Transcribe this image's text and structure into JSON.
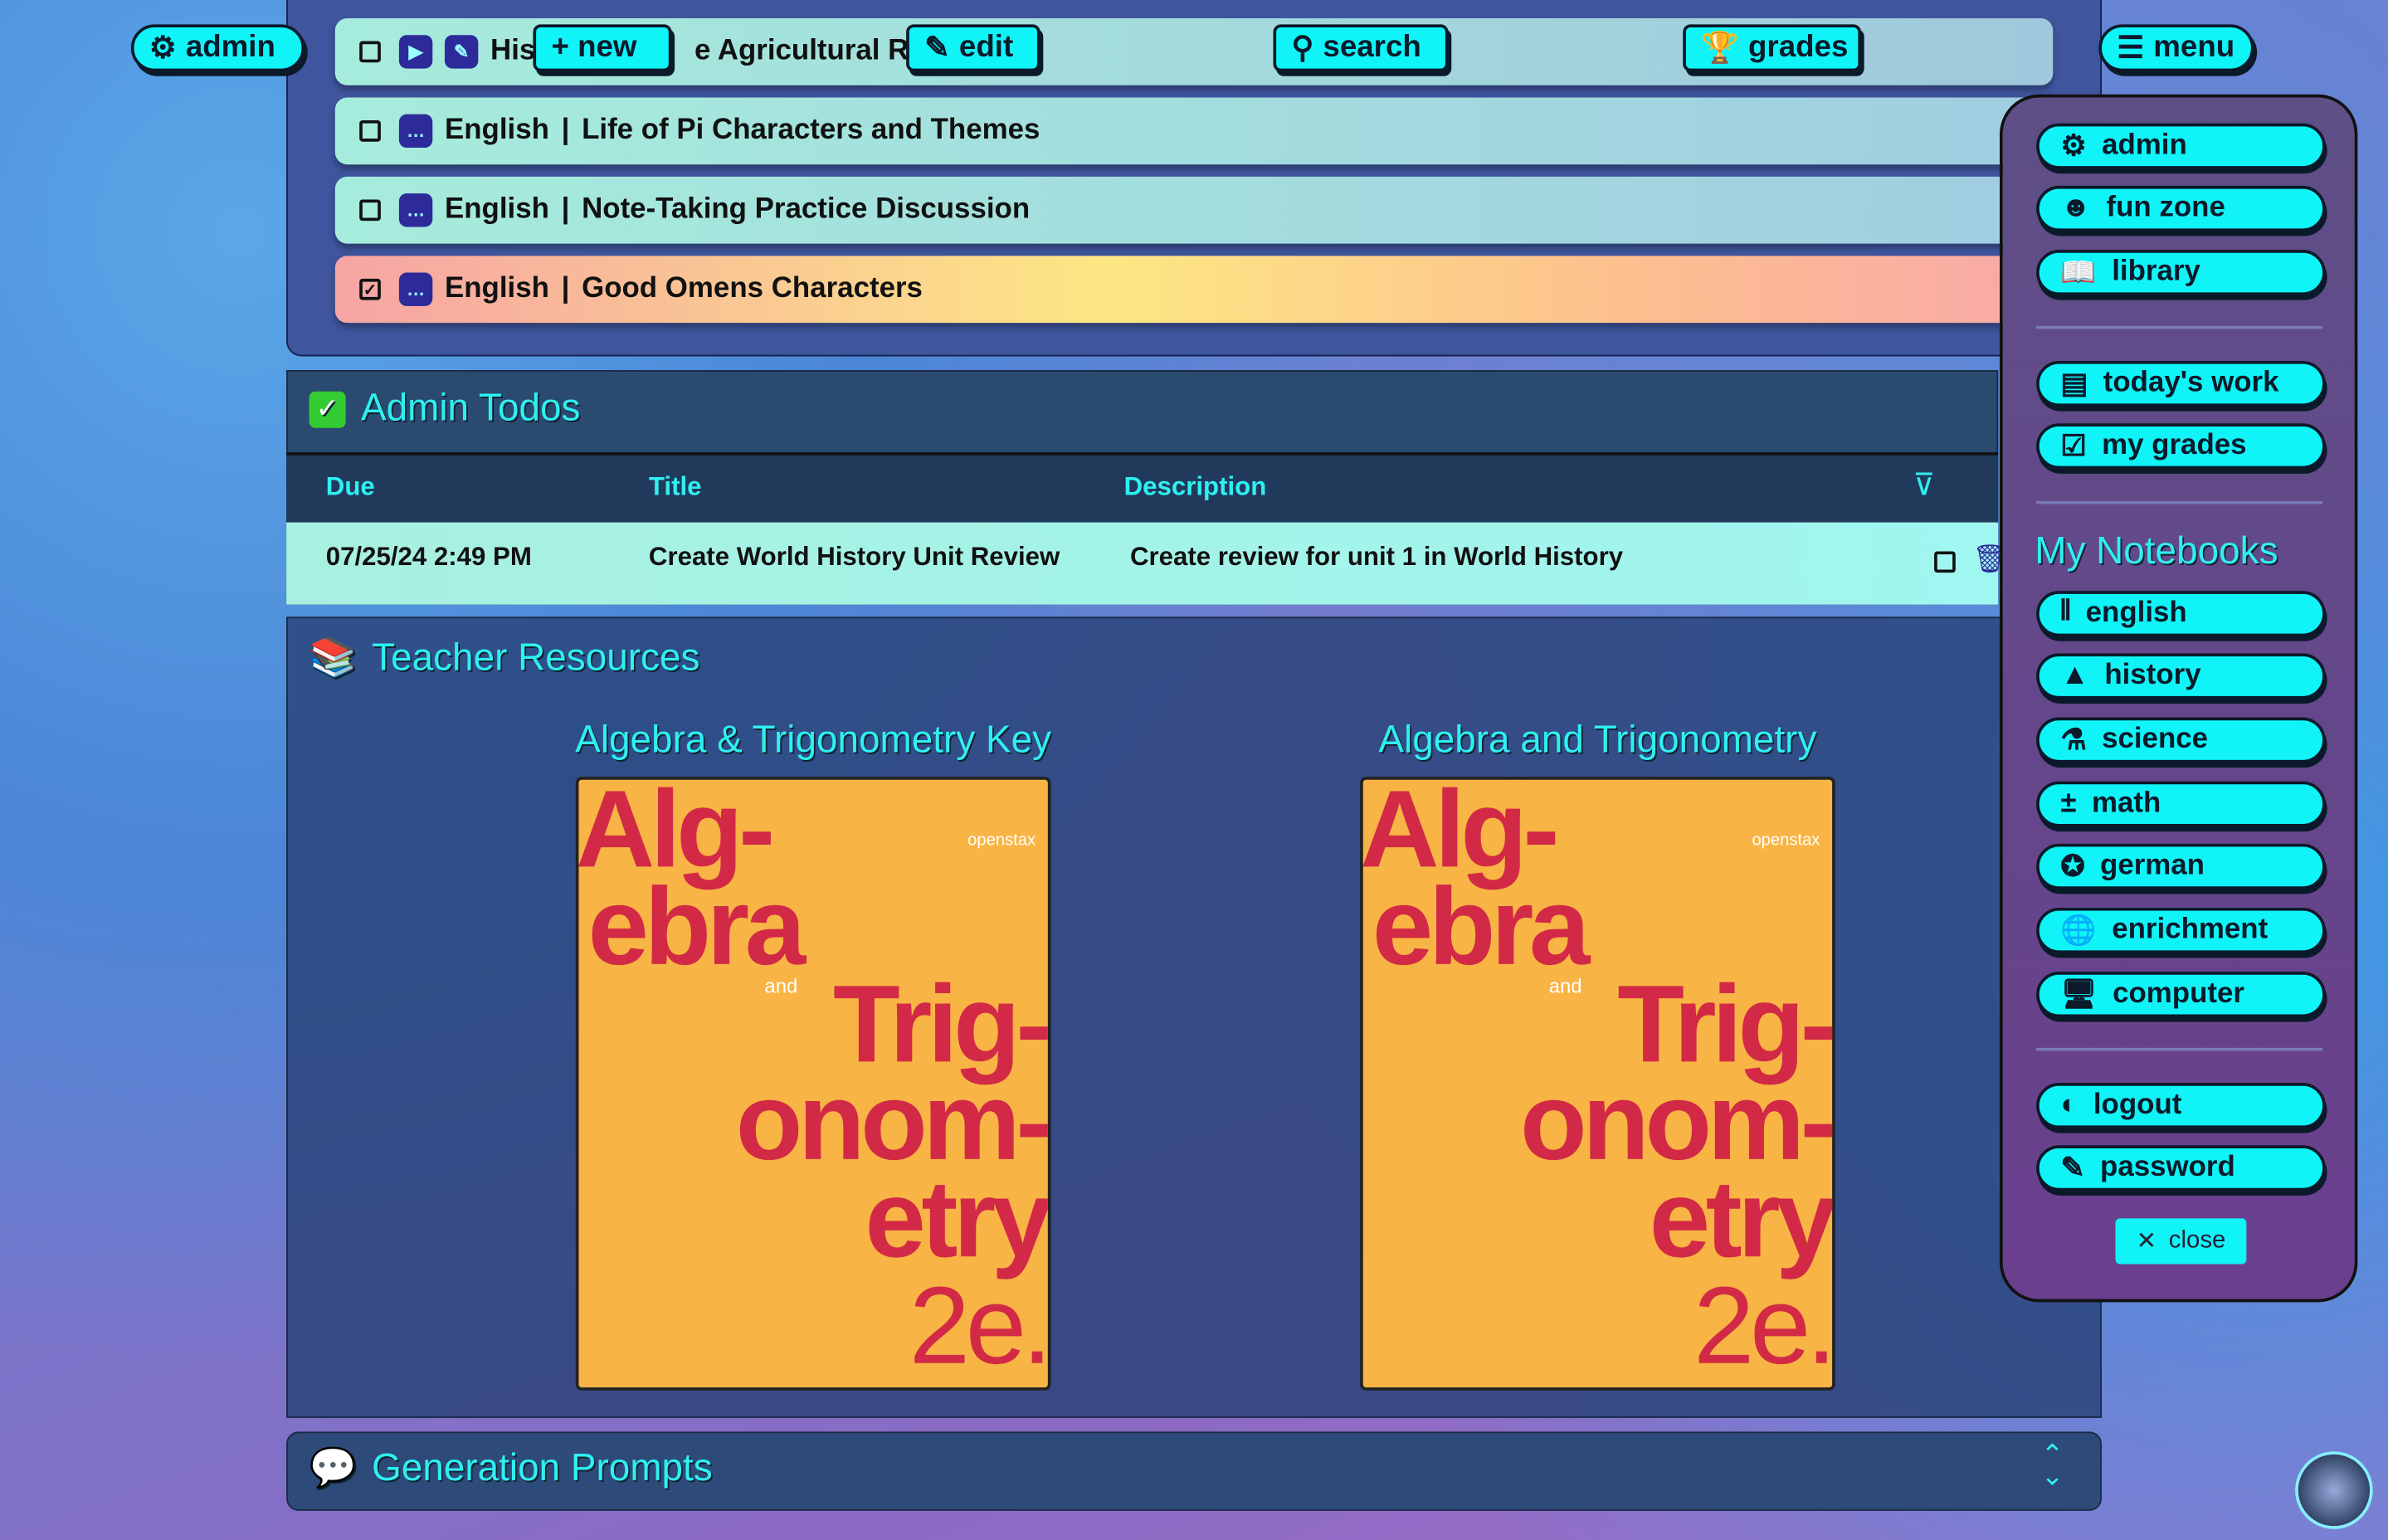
{
  "top_buttons": {
    "admin": "admin",
    "new": "+ new",
    "edit": "edit",
    "search": "search",
    "grades": "grades",
    "menu": "menu"
  },
  "assignments": [
    {
      "visible_parts": [
        "His",
        "e Agricultural Re"
      ],
      "icons": [
        "video-icon",
        "pencil-icon"
      ],
      "checked": false
    },
    {
      "subject": "English",
      "separator": "|",
      "title": "Life of Pi Characters and Themes",
      "icon": "chat-icon",
      "checked": false
    },
    {
      "subject": "English",
      "separator": "|",
      "title": "Note-Taking Practice Discussion",
      "icon": "chat-icon",
      "checked": false
    },
    {
      "subject": "English",
      "separator": "|",
      "title": "Good Omens Characters",
      "icon": "chat-icon",
      "checked": true
    }
  ],
  "admin_todos": {
    "title": "Admin Todos",
    "columns": [
      "Due",
      "Title",
      "Description"
    ],
    "rows": [
      {
        "due": "07/25/24 2:49 PM",
        "title": "Create World History Unit Review",
        "description": "Create review for unit 1 in World History"
      }
    ]
  },
  "teacher_resources": {
    "title": "Teacher Resources",
    "books": [
      {
        "title": "Algebra & Trigonometry Key",
        "cover": {
          "l1": "Alg-",
          "l2": "ebra",
          "and": "and",
          "l3": "Trig-",
          "l4": "onom-",
          "l5": "etry",
          "ed": "2e.",
          "brand": "openstax"
        }
      },
      {
        "title": "Algebra and Trigonometry",
        "cover": {
          "l1": "Alg-",
          "l2": "ebra",
          "and": "and",
          "l3": "Trig-",
          "l4": "onom-",
          "l5": "etry",
          "ed": "2e.",
          "brand": "openstax"
        }
      }
    ]
  },
  "generation_prompts": {
    "title": "Generation Prompts"
  },
  "menu": {
    "items1": [
      "admin",
      "fun zone",
      "library"
    ],
    "items2": [
      "today's work",
      "my grades"
    ],
    "notebooks_title": "My Notebooks",
    "notebooks": [
      "english",
      "history",
      "science",
      "math",
      "german",
      "enrichment",
      "computer"
    ],
    "items3": [
      "logout",
      "password"
    ],
    "close": "close"
  },
  "colors": {
    "accent": "#10f4f8",
    "panel": "#3f559e",
    "menu": "#5e4f86"
  }
}
